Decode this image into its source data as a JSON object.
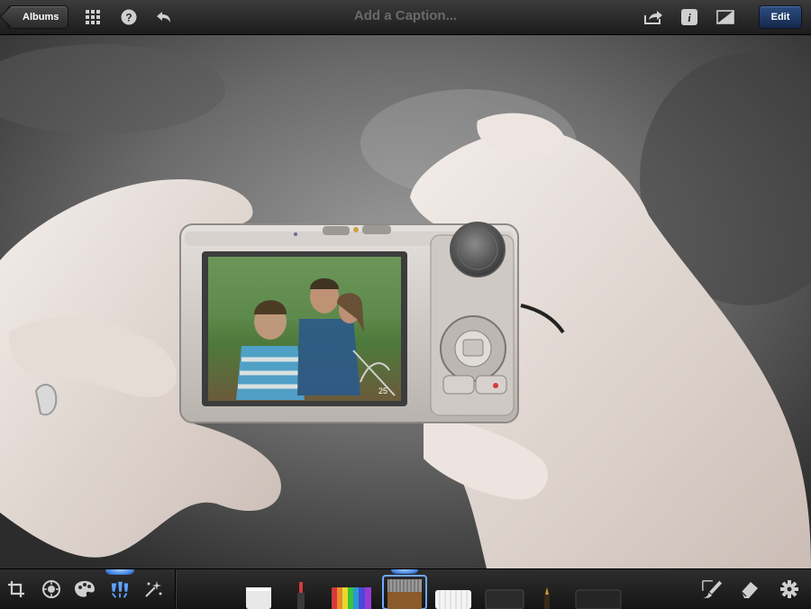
{
  "toolbar": {
    "back_label": "Albums",
    "caption_placeholder": "Add a Caption...",
    "edit_label": "Edit",
    "left_icons": [
      "grid-icon",
      "help-icon",
      "undo-icon"
    ],
    "right_icons": [
      "share-icon",
      "info-icon",
      "compare-icon"
    ]
  },
  "photo": {
    "description_colors": {
      "accent": "#5ea0ff",
      "edit_button": "#1f3a6a"
    }
  },
  "bottom_toolbar": {
    "tools": [
      {
        "name": "crop-icon",
        "active": false
      },
      {
        "name": "exposure-icon",
        "active": false
      },
      {
        "name": "color-palette-icon",
        "active": false
      },
      {
        "name": "brushes-icon",
        "active": true
      },
      {
        "name": "effects-icon",
        "active": false
      }
    ],
    "brushes": [
      "soften-brush",
      "repair-brush",
      "saturate-brush",
      "desaturate-brush",
      "lighten-brush",
      "darken-brush",
      "sharpen-brush",
      "blur-brush"
    ],
    "selected_brush": "desaturate-brush",
    "right_icons": [
      "brush-settings-icon",
      "eraser-icon",
      "gear-icon"
    ]
  }
}
